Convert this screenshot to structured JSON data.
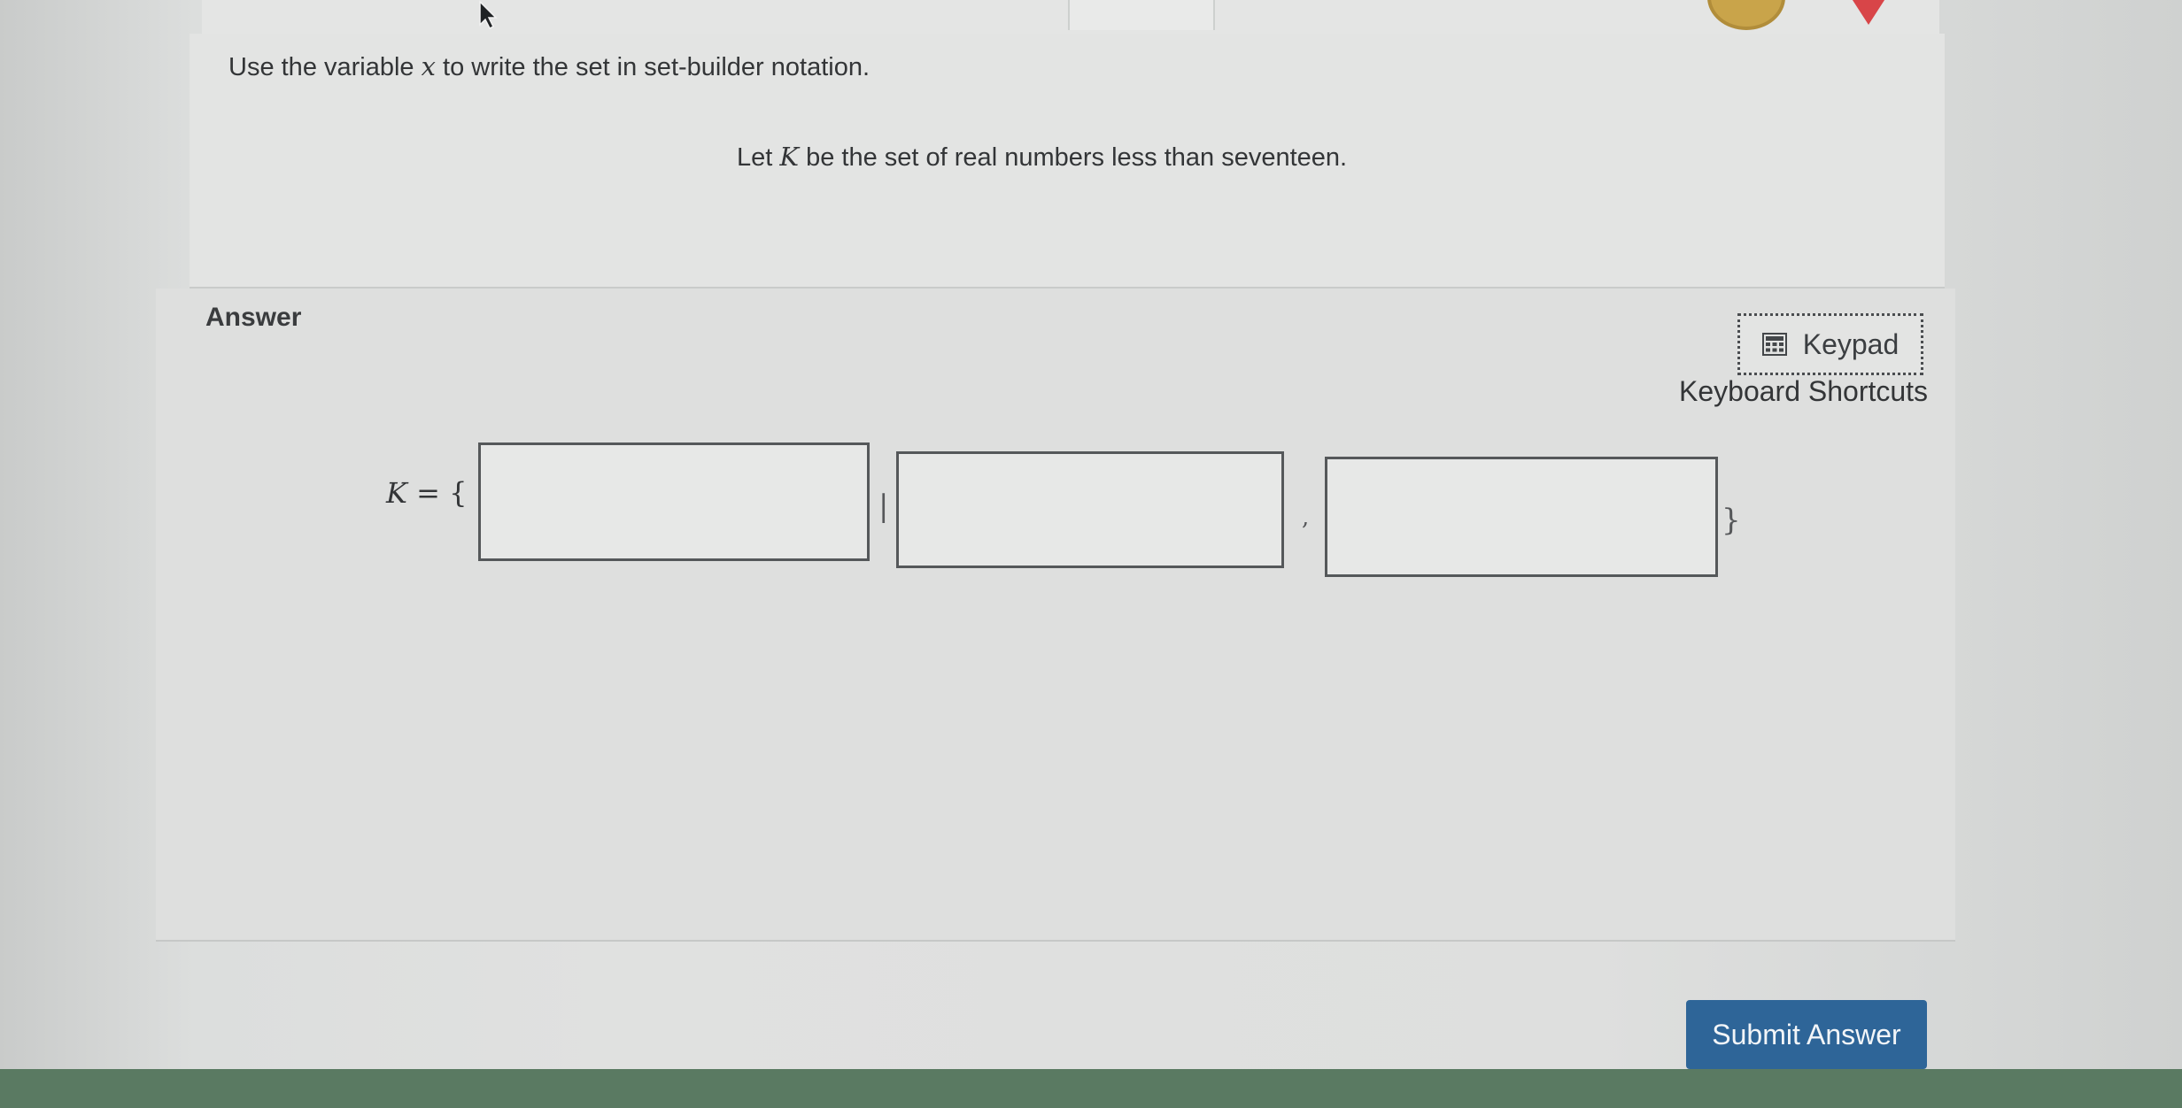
{
  "question": {
    "instruction_pre": "Use the variable ",
    "instruction_var": "x",
    "instruction_post": " to write the set in set-builder notation.",
    "problem_pre": "Let ",
    "problem_var": "K",
    "problem_post": " be the set of real numbers less than seventeen."
  },
  "answer": {
    "heading": "Answer",
    "keypad_label": "Keypad",
    "keypad_icon": "calculator-icon",
    "shortcuts_label": "Keyboard Shortcuts",
    "set_var": "K",
    "equals_open": "= {",
    "separator_bar": "|",
    "separator_comma": ",",
    "close_brace": "}",
    "inputs": [
      "",
      "",
      ""
    ]
  },
  "footer": {
    "submit_label": "Submit Answer"
  },
  "colors": {
    "submit_bg": "#2e6598",
    "footer_strip": "#5a7a62",
    "heart": "#d84548",
    "coin": "#c9a44a"
  }
}
